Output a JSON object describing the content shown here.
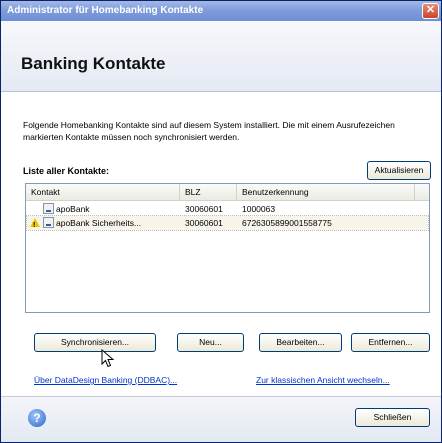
{
  "window": {
    "title": "Administrator für Homebanking Kontakte",
    "close_glyph": "✕"
  },
  "header": {
    "title": "Banking Kontakte"
  },
  "description": "Folgende Homebanking Kontakte sind auf diesem System installiert. Die mit einem Ausrufezeichen markierten Kontakte müssen noch synchronisiert werden.",
  "list": {
    "label": "Liste aller Kontakte:",
    "refresh_button": "Aktualisieren",
    "columns": [
      "Kontakt",
      "BLZ",
      "Benutzerkennung"
    ],
    "rows": [
      {
        "name": "apoBank",
        "blz": "30060601",
        "user_id": "1000063",
        "warning": false
      },
      {
        "name": "apoBank Sicherheits...",
        "blz": "30060601",
        "user_id": "6726305899001558775",
        "warning": true
      }
    ]
  },
  "actions": {
    "sync": "Synchronisieren...",
    "new": "Neu...",
    "edit": "Bearbeiten...",
    "remove": "Entfernen..."
  },
  "links": {
    "about": "Über DataDesign Banking (DDBAC)...",
    "classic_view": "Zur klassischen Ansicht wechseln..."
  },
  "footer": {
    "help_glyph": "?",
    "close_button": "Schließen"
  },
  "icons": {
    "warning": "warning-icon",
    "bank": "bank-contact-icon",
    "help": "help-icon",
    "cursor": "mouse-cursor-icon"
  }
}
